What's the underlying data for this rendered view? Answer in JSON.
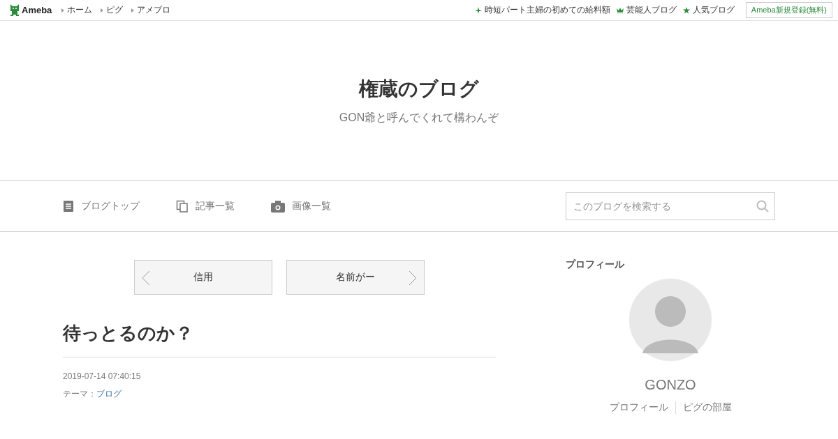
{
  "topbar": {
    "logo": "Ameba",
    "links": [
      "ホーム",
      "ピグ",
      "アメブロ"
    ],
    "right_links": [
      {
        "kind": "sparkle",
        "label": "時短パート主婦の初めての給料額"
      },
      {
        "kind": "crown",
        "label": "芸能人ブログ"
      },
      {
        "kind": "star",
        "label": "人気ブログ"
      }
    ],
    "register": "Ameba新規登録(無料)"
  },
  "blog": {
    "title": "権蔵のブログ",
    "subtitle": "GON爺と呼んでくれて構わんぞ"
  },
  "nav": {
    "items": [
      {
        "kind": "doc",
        "label": "ブログトップ"
      },
      {
        "kind": "copy",
        "label": "記事一覧"
      },
      {
        "kind": "camera",
        "label": "画像一覧"
      }
    ],
    "search": {
      "placeholder": "このブログを検索する"
    }
  },
  "pager": [
    {
      "kind": "prev",
      "label": "信用"
    },
    {
      "kind": "next",
      "label": "名前がー"
    }
  ],
  "article": {
    "title": "待っとるのか？",
    "date": "2019-07-14 07:40:15",
    "theme_label": "テーマ：",
    "theme": "ブログ"
  },
  "profile": {
    "heading": "プロフィール",
    "name": "GONZO",
    "links": [
      "プロフィール",
      "ピグの部屋"
    ]
  }
}
